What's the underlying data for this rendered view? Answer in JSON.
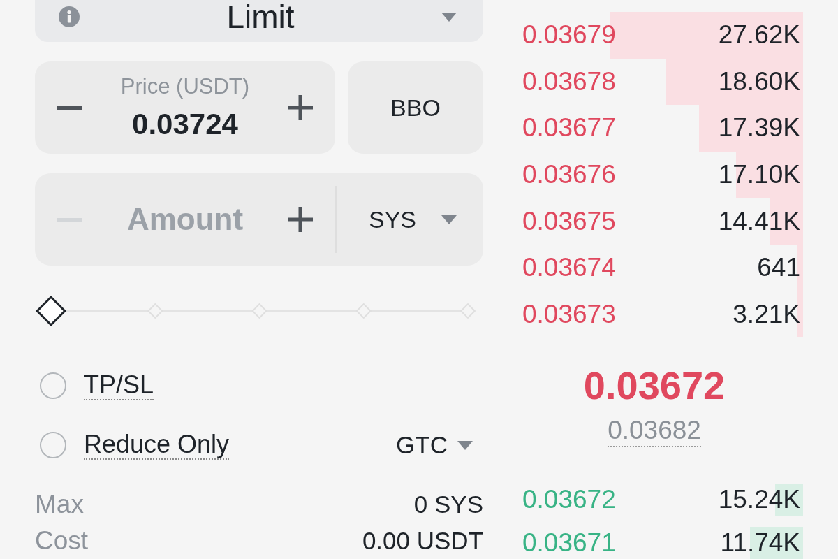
{
  "order_form": {
    "order_type": {
      "value": "Limit"
    },
    "price": {
      "label": "Price (USDT)",
      "value": "0.03724",
      "decrease_disabled": false
    },
    "bbo_button": "BBO",
    "amount": {
      "placeholder": "Amount",
      "decrease_disabled": true,
      "unit": "SYS"
    },
    "slider": {
      "level": 0
    },
    "options": [
      {
        "label": "TP/SL",
        "checked": false
      },
      {
        "label": "Reduce Only",
        "checked": false
      }
    ],
    "time_in_force": "GTC",
    "summary": [
      {
        "label": "Max",
        "value": "0 SYS"
      },
      {
        "label": "Cost",
        "value": "0.00 USDT"
      }
    ]
  },
  "order_book": {
    "asks": [
      {
        "price": "0.03679",
        "amount": "27.62K",
        "level": 0.69
      },
      {
        "price": "0.03678",
        "amount": "18.60K",
        "level": 0.49
      },
      {
        "price": "0.03677",
        "amount": "17.39K",
        "level": 0.37
      },
      {
        "price": "0.03676",
        "amount": "17.10K",
        "level": 0.24
      },
      {
        "price": "0.03675",
        "amount": "14.41K",
        "level": 0.12
      },
      {
        "price": "0.03674",
        "amount": "641",
        "level": 0.02
      },
      {
        "price": "0.03673",
        "amount": "3.21K",
        "level": 0.02
      }
    ],
    "last_price": "0.03672",
    "mark_price": "0.03682",
    "bids": [
      {
        "price": "0.03672",
        "amount": "15.24K",
        "level": 0.1
      },
      {
        "price": "0.03671",
        "amount": "11.74K",
        "level": 0.19
      }
    ]
  }
}
